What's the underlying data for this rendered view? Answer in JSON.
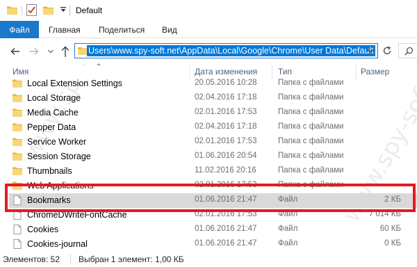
{
  "window": {
    "title": "Default"
  },
  "ribbon": {
    "tabs": [
      {
        "label": "Файл"
      },
      {
        "label": "Главная"
      },
      {
        "label": "Поделиться"
      },
      {
        "label": "Вид"
      }
    ]
  },
  "address": {
    "path": "Users\\www.spy-soft.net\\AppData\\Local\\Google\\Chrome\\User Data\\Default"
  },
  "columns": {
    "name": "Имя",
    "date": "Дата изменения",
    "type": "Тип",
    "size": "Размер"
  },
  "files": [
    {
      "name": "Local Extension Settings",
      "date": "20.05.2016 10:28",
      "type": "Папка с файлами",
      "size": "",
      "icon": "folder-icon"
    },
    {
      "name": "Local Storage",
      "date": "02.04.2016 17:18",
      "type": "Папка с файлами",
      "size": "",
      "icon": "folder-icon"
    },
    {
      "name": "Media Cache",
      "date": "02.01.2016 17:53",
      "type": "Папка с файлами",
      "size": "",
      "icon": "folder-icon"
    },
    {
      "name": "Pepper Data",
      "date": "02.04.2016 17:18",
      "type": "Папка с файлами",
      "size": "",
      "icon": "folder-icon"
    },
    {
      "name": "Service Worker",
      "date": "02.01.2016 17:53",
      "type": "Папка с файлами",
      "size": "",
      "icon": "folder-icon"
    },
    {
      "name": "Session Storage",
      "date": "01.06.2016 20:54",
      "type": "Папка с файлами",
      "size": "",
      "icon": "folder-icon"
    },
    {
      "name": "Thumbnails",
      "date": "11.02.2016 20:16",
      "type": "Папка с файлами",
      "size": "",
      "icon": "folder-icon"
    },
    {
      "name": "Web Applications",
      "date": "02.01.2016 17:53",
      "type": "Папка с файлами",
      "size": "",
      "icon": "folder-icon"
    },
    {
      "name": "Bookmarks",
      "date": "01.06.2016 21:47",
      "type": "Файл",
      "size": "2 КБ",
      "icon": "file-icon",
      "selected": true
    },
    {
      "name": "ChromeDWriteFontCache",
      "date": "02.01.2016 17:53",
      "type": "Файл",
      "size": "7 014 КБ",
      "icon": "file-icon"
    },
    {
      "name": "Cookies",
      "date": "01.06.2016 21:47",
      "type": "Файл",
      "size": "60 КБ",
      "icon": "file-icon"
    },
    {
      "name": "Cookies-journal",
      "date": "01.06.2016 21:47",
      "type": "Файл",
      "size": "0 КБ",
      "icon": "file-icon"
    }
  ],
  "status": {
    "count": "Элементов: 52",
    "selection": "Выбран 1 элемент: 1,00 КБ"
  },
  "watermark": "www.spy-soft.net",
  "colors": {
    "accent": "#1979ca",
    "selection": "#0078d7",
    "annotation": "#e31b22",
    "folder": "#f8d775"
  }
}
